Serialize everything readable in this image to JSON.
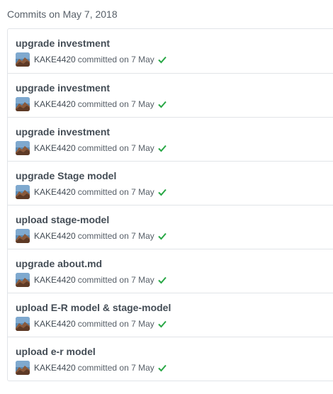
{
  "group": {
    "header": "Commits on May 7, 2018"
  },
  "colors": {
    "border": "#e1e4e8",
    "check": "#28a745",
    "muted": "#586069"
  },
  "commits": [
    {
      "title": "upgrade investment",
      "author": "KAKE4420",
      "meta": "committed on 7 May",
      "status_icon": "check-icon"
    },
    {
      "title": "upgrade investment",
      "author": "KAKE4420",
      "meta": "committed on 7 May",
      "status_icon": "check-icon"
    },
    {
      "title": "upgrade investment",
      "author": "KAKE4420",
      "meta": "committed on 7 May",
      "status_icon": "check-icon"
    },
    {
      "title": "upgrade Stage model",
      "author": "KAKE4420",
      "meta": "committed on 7 May",
      "status_icon": "check-icon"
    },
    {
      "title": "upload stage-model",
      "author": "KAKE4420",
      "meta": "committed on 7 May",
      "status_icon": "check-icon"
    },
    {
      "title": "upgrade about.md",
      "author": "KAKE4420",
      "meta": "committed on 7 May",
      "status_icon": "check-icon"
    },
    {
      "title": "upload E-R model & stage-model",
      "author": "KAKE4420",
      "meta": "committed on 7 May",
      "status_icon": "check-icon"
    },
    {
      "title": "upload e-r model",
      "author": "KAKE4420",
      "meta": "committed on 7 May",
      "status_icon": "check-icon"
    }
  ]
}
